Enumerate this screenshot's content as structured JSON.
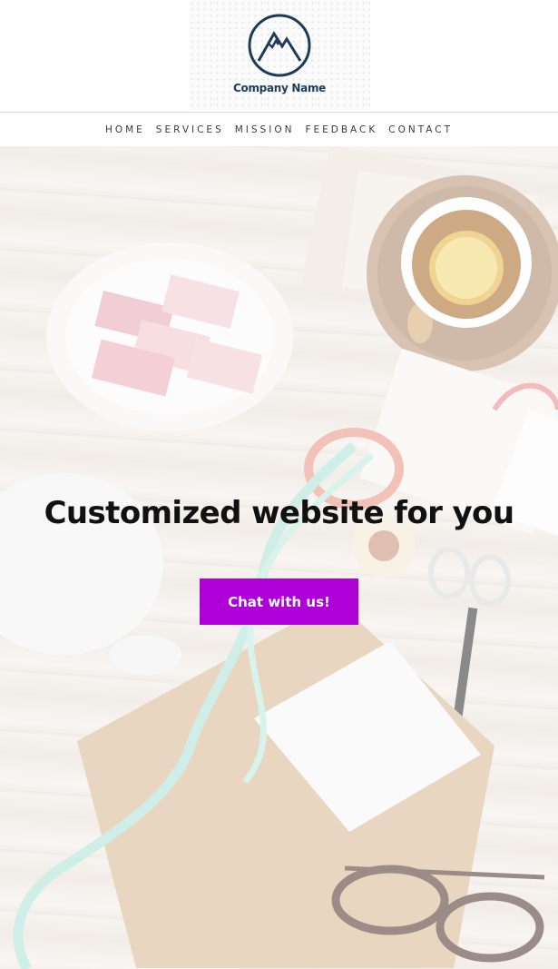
{
  "brand": {
    "company_name": "Company Name",
    "logo_icon": "mountain-logo-icon",
    "logo_color": "#1f3b5a"
  },
  "nav": {
    "items": [
      "HOME",
      "SERVICES",
      "MISSION",
      "FEEDBACK",
      "CONTACT"
    ]
  },
  "hero": {
    "title": "Customized website for you",
    "cta_label": "Chat with us!",
    "cta_color": "#b000d8",
    "background_image": "flat-lay-desk-with-tea-marshmallows-ribbon-scissors-glasses"
  }
}
